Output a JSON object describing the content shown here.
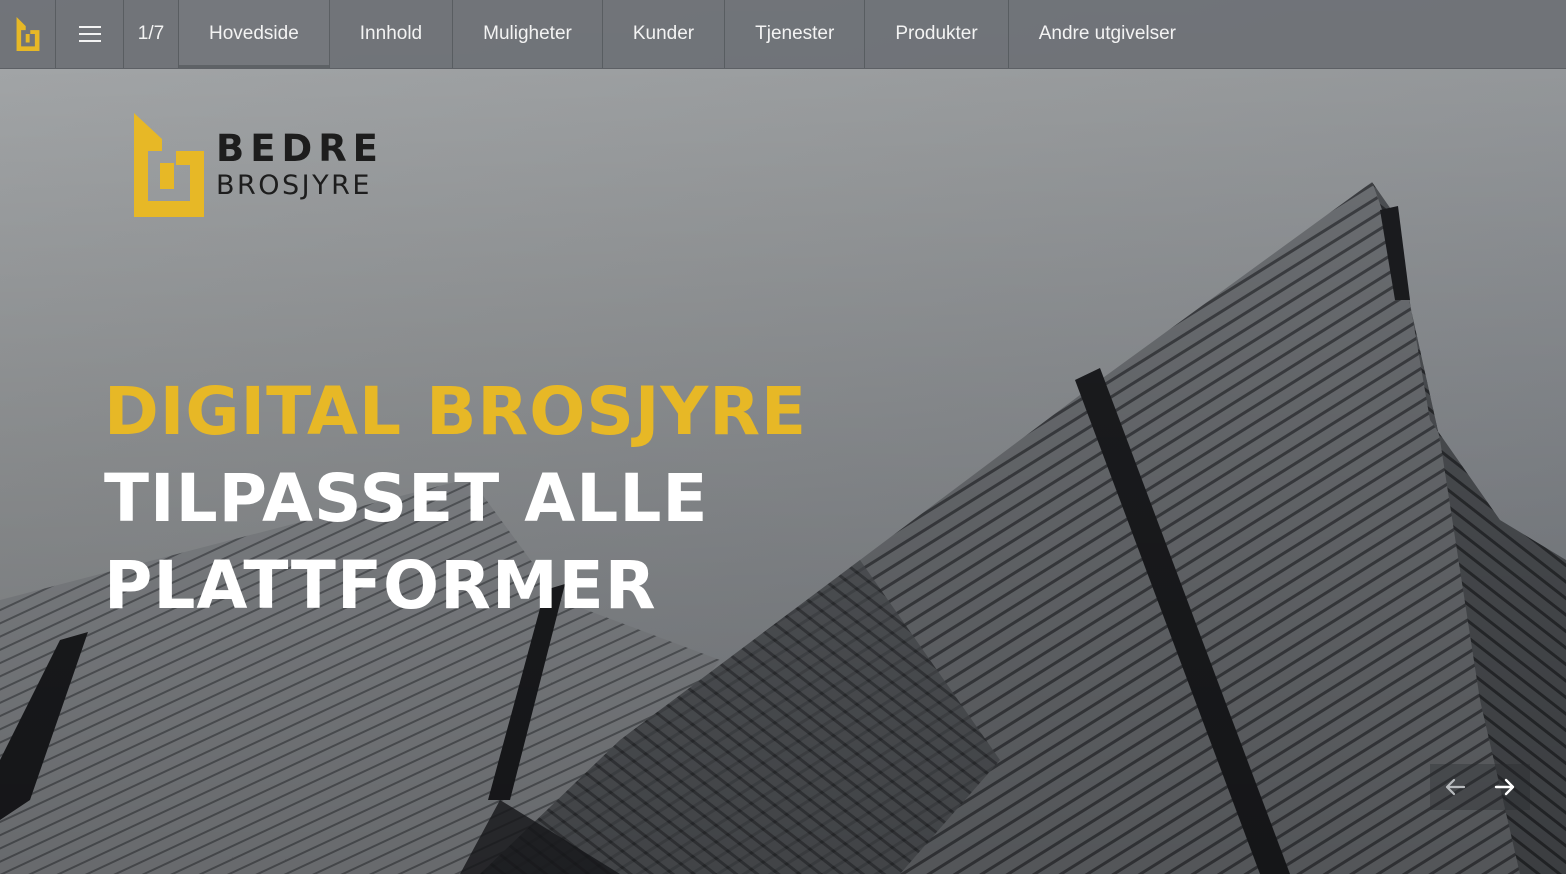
{
  "nav": {
    "page_indicator": "1/7",
    "tabs": [
      {
        "label": "Hovedside",
        "active": true
      },
      {
        "label": "Innhold"
      },
      {
        "label": "Muligheter"
      },
      {
        "label": "Kunder"
      },
      {
        "label": "Tjenester"
      },
      {
        "label": "Produkter"
      },
      {
        "label": "Andre utgivelser"
      }
    ],
    "menu_icon": "hamburger-menu-icon",
    "logo_icon": "bedre-brosjyre-logo"
  },
  "brand": {
    "line1": "BEDRE",
    "line2": "BROSJYRE"
  },
  "hero": {
    "headline_yellow": "DIGITAL BROSJYRE",
    "headline_white_1": "TILPASSET ALLE",
    "headline_white_2": "PLATTFORMER"
  },
  "slider": {
    "prev_icon": "arrow-left-icon",
    "next_icon": "arrow-right-icon"
  },
  "colors": {
    "accent_yellow": "#e7b826",
    "topbar": "#6c7075",
    "text_white": "#ffffff"
  }
}
